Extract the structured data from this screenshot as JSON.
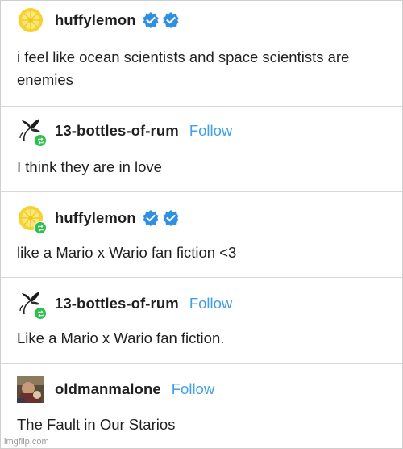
{
  "posts": [
    {
      "username": "huffylemon",
      "verified": true,
      "follow": "",
      "text": "i feel like ocean scientists and space scientists are enemies",
      "avatar_icon": "lemon-icon",
      "reblogged": false
    },
    {
      "username": "13-bottles-of-rum",
      "verified": false,
      "follow": "Follow",
      "text": "I think they are in love",
      "avatar_icon": "plant-icon",
      "reblogged": true
    },
    {
      "username": "huffylemon",
      "verified": true,
      "follow": "",
      "text": "like a Mario x Wario fan fiction <3",
      "avatar_icon": "lemon-icon",
      "reblogged": true
    },
    {
      "username": "13-bottles-of-rum",
      "verified": false,
      "follow": "Follow",
      "text": "Like a Mario x Wario fan fiction.",
      "avatar_icon": "plant-icon",
      "reblogged": true
    },
    {
      "username": "oldmanmalone",
      "verified": false,
      "follow": "Follow",
      "text": "The Fault in Our Starios",
      "avatar_icon": "photo-avatar-icon",
      "reblogged": false
    }
  ],
  "watermark": "imgflip.com",
  "colors": {
    "follow": "#3fa0e6",
    "verified_badge": "#2f8fe3",
    "reblog_badge": "#2fbf4f",
    "lemon": "#f6d22c"
  }
}
